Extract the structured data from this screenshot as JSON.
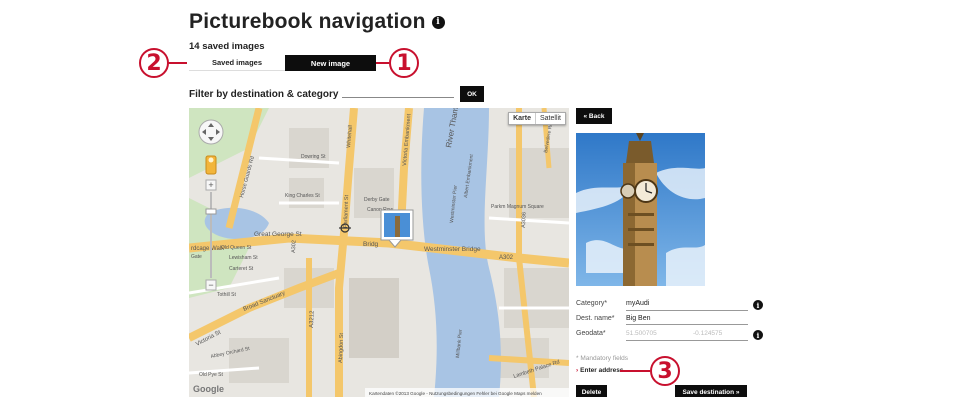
{
  "page": {
    "title": "Picturebook navigation",
    "info_icon": "i",
    "saved_count": "14 saved images"
  },
  "tabs": [
    {
      "label": "Saved images",
      "active": true
    },
    {
      "label": "New image",
      "active": false
    }
  ],
  "callouts": [
    "1",
    "2",
    "3"
  ],
  "filter": {
    "label": "Filter by destination & category",
    "value": "",
    "button_label": "OK"
  },
  "map": {
    "type_buttons": [
      "Karte",
      "Satellit"
    ],
    "active_type": "Karte",
    "labels": {
      "river": "River Thames",
      "westminster_bridge": "Westminster Bridge",
      "a302": "A302",
      "great_george": "Great George St",
      "bridge_st": "Bridg",
      "parliament_st": "Parliament St",
      "whitehall": "Whitehall",
      "victoria_emb": "Victoria Embankment",
      "horse_guards": "Horse Guards Rd",
      "king_charles": "King Charles St",
      "derby_gate": "Derby Gate",
      "dowring": "Dowring St",
      "canon_row": "Canon Row",
      "old_queen": "Old Queen St",
      "lewisham": "Lewisham St",
      "carteret": "Carteret St",
      "tothill": "Tothill St",
      "broad_sanctuary": "Broad Sanctuary",
      "victoria_st": "Victoria St",
      "old_pye": "Old Pye St",
      "abbey_orchard": "Abbey Orchard St",
      "a3212": "A3212",
      "abingdon": "Abingdon St",
      "parliament_sq": "Parliament Sq",
      "birdcage": "rdcage Walk",
      "gate": "Gate",
      "albert_emb": "Albert Embankment",
      "york_rd": "York Rd",
      "park_plaza": "Parkm Magnum Square",
      "lambeth_palace": "Lambeth Palace Rd",
      "a3036": "A3036",
      "belvedere": "Belvedere Rd",
      "millbank": "Millbank Pier",
      "westminster_pier": "Westminster Pier",
      "google": "Google",
      "attribution": "Kartendaten ©2013 Google - Nutzungsbedingungen  Fehler bei Google Maps melden"
    }
  },
  "detail": {
    "back_label": "« Back",
    "category_label": "Category*",
    "category_value": "myAudi",
    "dest_label": "Dest. name*",
    "dest_value": "Big Ben",
    "geo_label": "Geodata*",
    "geo_lat": "51.500705",
    "geo_lng": "-0.124575",
    "mandatory_note": "* Mandatory fields",
    "enter_address": "Enter address",
    "delete_label": "Delete",
    "save_label": "Save destination »"
  },
  "colors": {
    "accent": "#c8102e",
    "button_bg": "#0d0d0d",
    "map_road": "#f4c76b",
    "map_water": "#a8c4e4",
    "map_land": "#e8e6e1"
  }
}
